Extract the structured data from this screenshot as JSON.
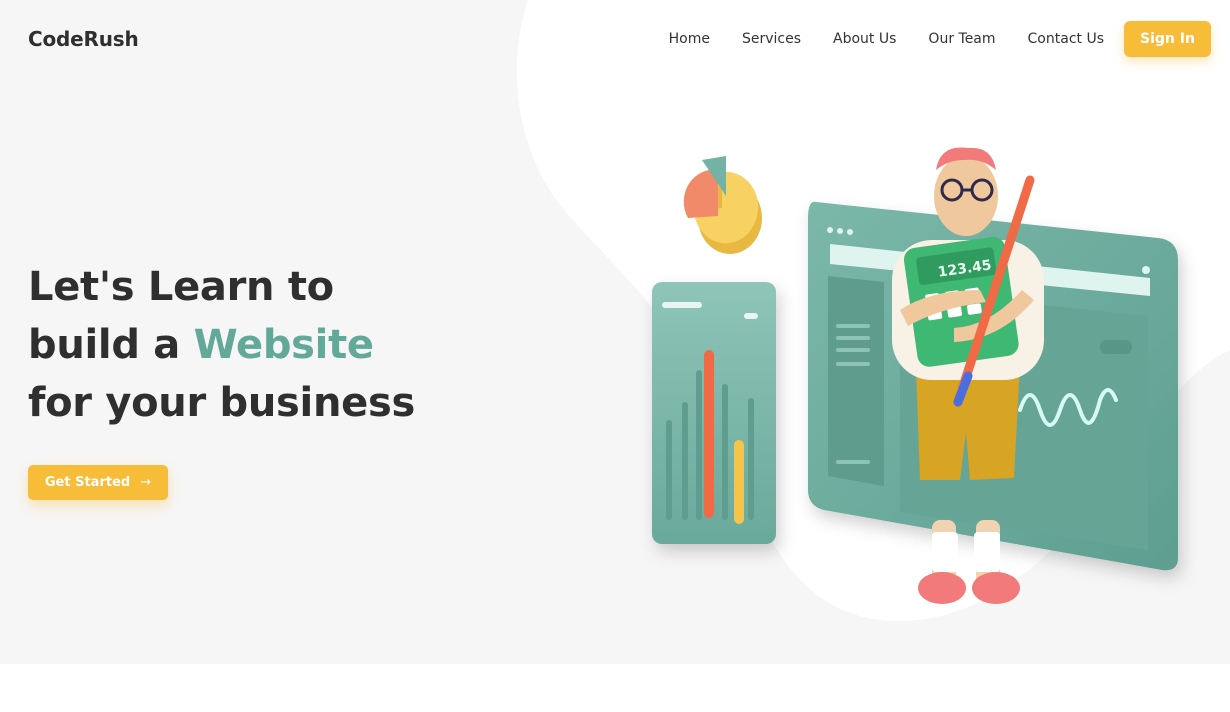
{
  "brand": {
    "name": "CodeRush",
    "accent_color": "#62a99a",
    "button_color": "#f7bd38"
  },
  "nav": {
    "items": [
      {
        "label": "Home"
      },
      {
        "label": "Services"
      },
      {
        "label": "About Us"
      },
      {
        "label": "Our Team"
      },
      {
        "label": "Contact Us"
      }
    ],
    "signin_label": "Sign In"
  },
  "hero": {
    "line1": "Let's Learn to",
    "line2_prefix": "build a ",
    "line2_accent": "Website",
    "line3": "for your business",
    "cta_label": "Get Started",
    "cta_icon": "arrow-right-icon",
    "calculator_text": "123.45"
  }
}
